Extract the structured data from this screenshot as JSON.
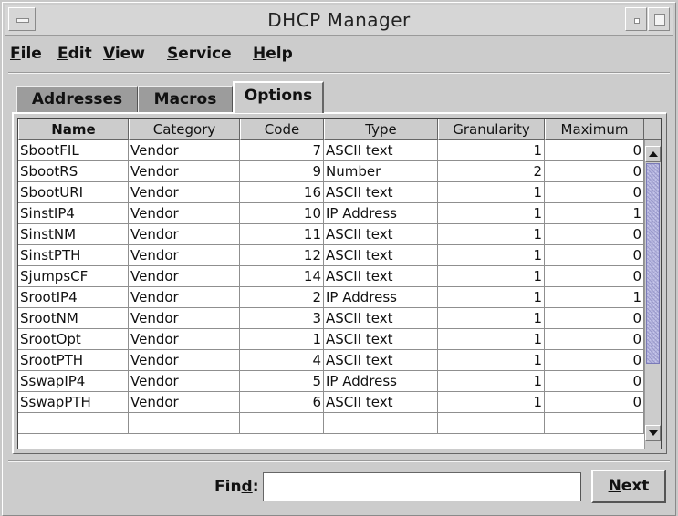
{
  "window": {
    "title": "DHCP Manager"
  },
  "menubar": {
    "items": [
      {
        "label": "File",
        "mnemonic": "F",
        "rest": "ile"
      },
      {
        "label": "Edit",
        "mnemonic": "E",
        "rest": "dit"
      },
      {
        "label": "View",
        "mnemonic": "V",
        "rest": "iew"
      },
      {
        "label": "Service",
        "mnemonic": "S",
        "rest": "ervice"
      },
      {
        "label": "Help",
        "mnemonic": "H",
        "rest": "elp"
      }
    ]
  },
  "tabs": [
    {
      "label": "Addresses",
      "active": false
    },
    {
      "label": "Macros",
      "active": false
    },
    {
      "label": "Options",
      "active": true
    }
  ],
  "table": {
    "columns": [
      "Name",
      "Category",
      "Code",
      "Type",
      "Granularity",
      "Maximum"
    ],
    "sorted_column": "Name",
    "rows": [
      [
        "SbootFIL",
        "Vendor",
        "7",
        "ASCII text",
        "1",
        "0"
      ],
      [
        "SbootRS",
        "Vendor",
        "9",
        "Number",
        "2",
        "0"
      ],
      [
        "SbootURI",
        "Vendor",
        "16",
        "ASCII text",
        "1",
        "0"
      ],
      [
        "SinstIP4",
        "Vendor",
        "10",
        "IP Address",
        "1",
        "1"
      ],
      [
        "SinstNM",
        "Vendor",
        "11",
        "ASCII text",
        "1",
        "0"
      ],
      [
        "SinstPTH",
        "Vendor",
        "12",
        "ASCII text",
        "1",
        "0"
      ],
      [
        "SjumpsCF",
        "Vendor",
        "14",
        "ASCII text",
        "1",
        "0"
      ],
      [
        "SrootIP4",
        "Vendor",
        "2",
        "IP Address",
        "1",
        "1"
      ],
      [
        "SrootNM",
        "Vendor",
        "3",
        "ASCII text",
        "1",
        "0"
      ],
      [
        "SrootOpt",
        "Vendor",
        "1",
        "ASCII text",
        "1",
        "0"
      ],
      [
        "SrootPTH",
        "Vendor",
        "4",
        "ASCII text",
        "1",
        "0"
      ],
      [
        "SswapIP4",
        "Vendor",
        "5",
        "IP Address",
        "1",
        "0"
      ],
      [
        "SswapPTH",
        "Vendor",
        "6",
        "ASCII text",
        "1",
        "0"
      ]
    ]
  },
  "find": {
    "label_mnemonic": "d",
    "label_pre": "Fin",
    "label_post": ":",
    "value": "",
    "next_mnemonic": "N",
    "next_rest": "ext"
  },
  "colors": {
    "window_bg": "#cccccc",
    "tab_inactive": "#9c9c9c",
    "scroll_thumb": "#b4b4dc",
    "table_bg": "#ffffff"
  }
}
